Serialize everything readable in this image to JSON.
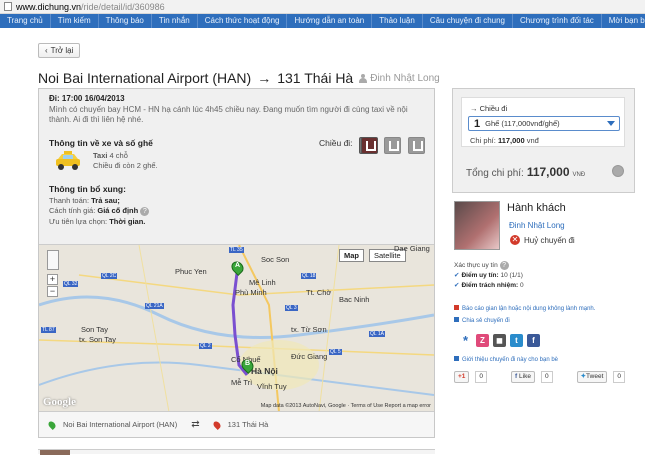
{
  "browser": {
    "url_host": "www.dichung.vn",
    "url_path": "/ride/detail/id/360986"
  },
  "nav": [
    "Trang chủ",
    "Tìm kiếm",
    "Thông báo",
    "Tin nhắn",
    "Cách thức hoạt động",
    "Hướng dẫn an toàn",
    "Thảo luận",
    "Câu chuyện đi chung",
    "Chương trình đối tác",
    "Mời bạn bè tham g"
  ],
  "back_label": "Trở lại",
  "route": {
    "from": "Noi Bai International Airport (HAN)",
    "arrow": "→",
    "to": "131 Thái Hà",
    "driver": "Đinh Nhật Long"
  },
  "trip": {
    "datetime": "Đi: 17:00 16/04/2013",
    "description": "Mình có chuyến bay HCM - HN hạ cánh lúc 4h45 chiều nay. Đang muốn tìm người đi cùng taxi về nội thành. Ai đi thì liên hệ nhé.",
    "car_section": "Thông tin về xe và số ghế",
    "car_type": "Taxi",
    "car_seats": "4 chỗ",
    "seats_left": "Chiều đi còn 2 ghế.",
    "direction_label": "Chiều đi:",
    "extra_title": "Thông tin bổ xung:",
    "payment_label": "Thanh toán:",
    "payment_value": "Trả sau;",
    "pricing_label": "Cách tính giá:",
    "pricing_value": "Giá cố định",
    "priority_label": "Ưu tiên lựa chọn:",
    "priority_value": "Thời gian."
  },
  "map": {
    "type_map": "Map",
    "type_satellite": "Satellite",
    "zoom_in": "+",
    "zoom_out": "−",
    "labels": [
      "Phuc Yen",
      "Soc Son",
      "Mê Linh",
      "Phù Minh",
      "Bac Ninh",
      "Son Tay",
      "tx. Son Tay",
      "tx. Từ Sơn",
      "Cổ Nhuế",
      "Hà Nội",
      "Đức Giang",
      "Mễ Trì",
      "Vĩnh Tuy",
      "Dae Giang",
      "Tt. Chờ"
    ],
    "road_tags": [
      "TL 35",
      "QL 2C",
      "QL 18",
      "QL 3",
      "QL 21A",
      "QL 32",
      "TL 87",
      "QL 1A",
      "QL 5",
      "QL 2"
    ],
    "marker_a": "A",
    "marker_b": "B",
    "google": "Google",
    "footer": "Map data ©2013 AutoNavi, Google · Terms of Use  Report a map error",
    "from_label": "Noi Bai International Airport (HAN)",
    "swap": "⇄",
    "to_label": "131 Thái Hà"
  },
  "booking": {
    "direction": "Chiều đi",
    "seat_count": "1",
    "seat_option": "Ghế (117,000vnđ/ghế)",
    "cost_label": "Chi phí:",
    "cost_value": "117,000",
    "cost_currency": "vnđ",
    "total_label": "Tổng chi phí:",
    "total_value": "117,000",
    "total_currency": "VNĐ"
  },
  "passenger": {
    "heading": "Hành khách",
    "name": "Đinh Nhật Long",
    "cancel": "Huỷ chuyến đi"
  },
  "trust": {
    "title": "Xác thực uy tín",
    "rep_label": "Điểm uy tín:",
    "rep_value": "10 (1/1)",
    "resp_label": "Điểm trách nhiệm:",
    "resp_value": "0"
  },
  "links": {
    "report": "Báo cáo gian lận hoặc nội dung không lành mạnh.",
    "share": "Chia sẻ chuyến đi",
    "invite": "Giới thiệu chuyến đi này cho bạn bè"
  },
  "social": {
    "gplus": "+1",
    "gplus_count": "0",
    "fb": "Like",
    "fb_count": "0",
    "tw": "Tweet",
    "tw_count": "0"
  },
  "colors": {
    "nav": "#2e6ebc",
    "accent_red": "#d23a2a",
    "route_purple": "#7a4fd0"
  }
}
